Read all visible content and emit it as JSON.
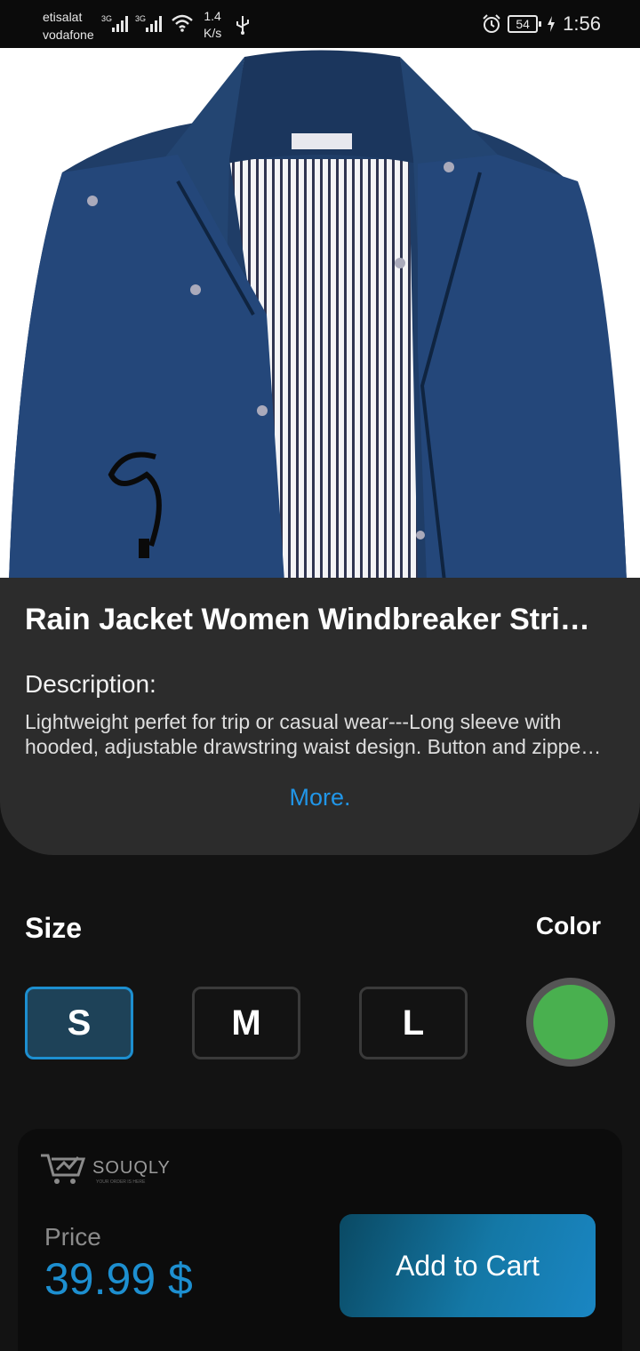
{
  "status_bar": {
    "carrier_1": "etisalat",
    "carrier_2": "vodafone",
    "network_1": "3G",
    "network_2": "3G",
    "speed_value": "1.4",
    "speed_unit": "K/s",
    "battery": "54",
    "time": "1:56",
    "icons": [
      "signal-icon",
      "signal-icon",
      "wifi-icon",
      "usb-icon",
      "alarm-icon",
      "battery-icon",
      "charging-icon"
    ]
  },
  "product": {
    "title": "Rain Jacket Women Windbreaker Stri…",
    "description_heading": "Description:",
    "description": "Lightweight perfet for trip or casual wear---Long sleeve with hooded, adjustable drawstring waist design. Button and zippe…",
    "more_link": "More."
  },
  "options": {
    "size_label": "Size",
    "color_label": "Color",
    "sizes": [
      "S",
      "M",
      "L"
    ],
    "selected_size": "S",
    "selected_color": "#49b04f"
  },
  "footer": {
    "brand": "SOUQLY",
    "brand_tagline": "YOUR ORDER IS HERE",
    "price_label": "Price",
    "price": "39.99 $",
    "add_to_cart": "Add to Cart"
  },
  "colors": {
    "accent": "#1d8fd0",
    "card": "#2c2c2c",
    "background": "#131313",
    "jacket": "#1f3d67"
  }
}
